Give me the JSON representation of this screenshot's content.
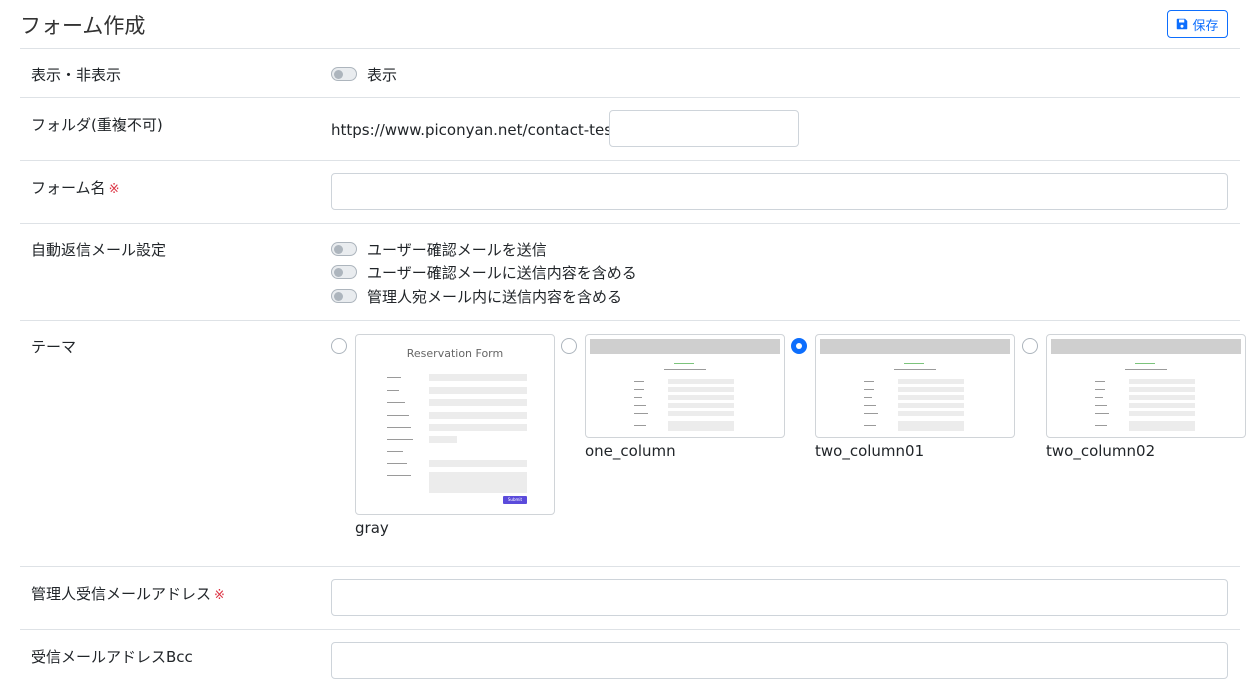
{
  "header": {
    "title": "フォーム作成",
    "save_label": "保存"
  },
  "rows": {
    "visibility": {
      "label": "表示・非表示",
      "toggle_label": "表示"
    },
    "folder": {
      "label": "フォルダ(重複不可)",
      "prefix": "https://www.piconyan.net/contact-test/",
      "value": ""
    },
    "form_name": {
      "label": "フォーム名",
      "required_mark": "※",
      "value": ""
    },
    "auto_reply": {
      "label": "自動返信メール設定",
      "options": [
        "ユーザー確認メールを送信",
        "ユーザー確認メールに送信内容を含める",
        "管理人宛メール内に送信内容を含める"
      ]
    },
    "theme": {
      "label": "テーマ",
      "options": [
        {
          "name": "gray",
          "preview_title": "Reservation Form",
          "submit": "Submit",
          "checked": false
        },
        {
          "name": "one_column",
          "checked": false
        },
        {
          "name": "two_column01",
          "checked": true
        },
        {
          "name": "two_column02",
          "checked": false
        }
      ]
    },
    "admin_email": {
      "label": "管理人受信メールアドレス",
      "required_mark": "※",
      "value": ""
    },
    "bcc": {
      "label": "受信メールアドレスBcc",
      "value": ""
    }
  },
  "colors": {
    "accent": "#0d6efd",
    "required": "#dc3545",
    "border": "#dee2e6"
  }
}
